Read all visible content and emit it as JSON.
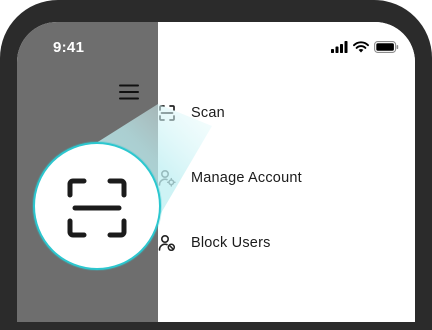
{
  "status_bar": {
    "time": "9:41",
    "icons": [
      "cellular-signal-icon",
      "wifi-icon",
      "battery-icon"
    ]
  },
  "drawer": {
    "toggle_icon": "hamburger-menu-icon",
    "items": [
      {
        "label": "Scan",
        "icon": "scan-icon"
      },
      {
        "label": "Manage Account",
        "icon": "user-settings-icon"
      },
      {
        "label": "Block Users",
        "icon": "user-block-icon"
      }
    ]
  },
  "callout": {
    "icon": "scan-icon",
    "accent_color": "#2cc7cf"
  },
  "colors": {
    "phone_frame": "#2b2b2b",
    "overlay": "#6e6e6e",
    "drawer_background": "#ffffff",
    "text": "#1b1b1b"
  }
}
